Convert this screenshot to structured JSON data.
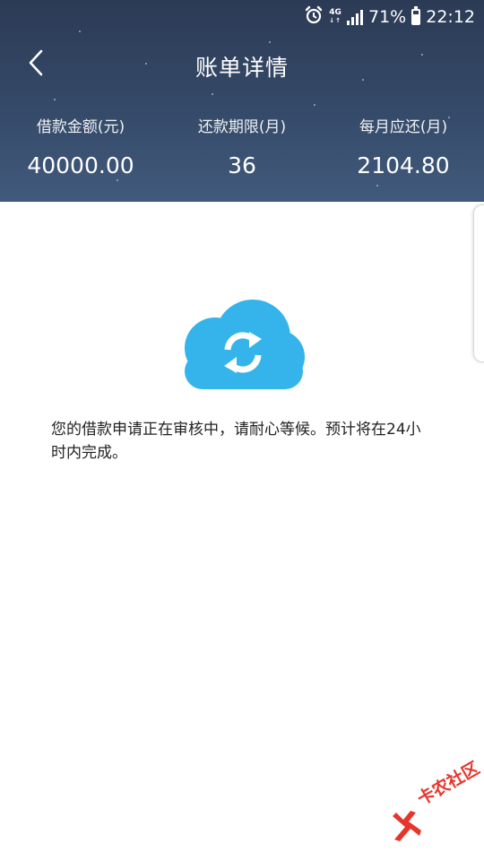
{
  "status_bar": {
    "network": "4G",
    "battery_percent": "71%",
    "battery_level": 0.71,
    "time": "22:12",
    "icons": [
      "alarm-icon",
      "network-4g-icon",
      "signal-icon",
      "battery-icon"
    ]
  },
  "nav": {
    "title": "账单详情",
    "back_icon": "chevron-left-icon"
  },
  "summary": {
    "items": [
      {
        "label": "借款金额(元)",
        "value": "40000.00"
      },
      {
        "label": "还款期限(月)",
        "value": "36"
      },
      {
        "label": "每月应还(月)",
        "value": "2104.80"
      }
    ]
  },
  "content": {
    "status_icon": "cloud-sync-icon",
    "message": "您的借款申请正在审核中，请耐心等候。预计将在24小时内完成。"
  },
  "watermark": {
    "text": "卡农社区"
  },
  "colors": {
    "header_top": "#2c3b55",
    "header_bottom": "#415a7c",
    "cloud": "#34b4ea",
    "watermark": "#e6352b",
    "text": "#222222"
  }
}
